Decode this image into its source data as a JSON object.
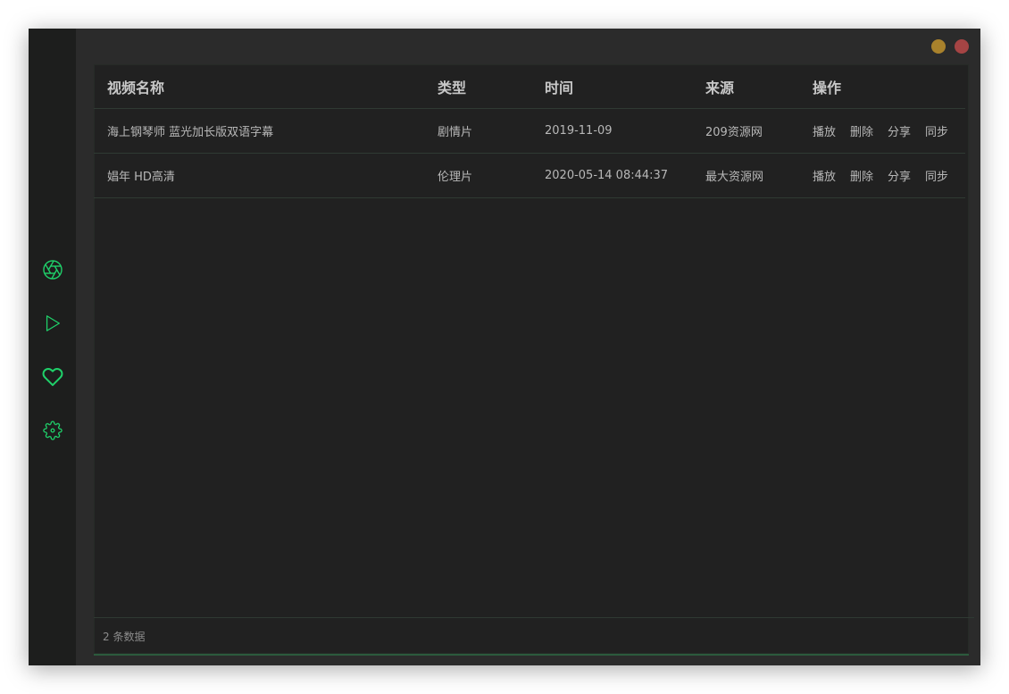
{
  "window": {
    "controls": {
      "minimize_color": "#a9822c",
      "close_color": "#a54444"
    }
  },
  "sidebar": {
    "accent_color": "#1fd16a",
    "items": [
      {
        "icon": "aperture-icon"
      },
      {
        "icon": "play-icon"
      },
      {
        "icon": "heart-icon"
      },
      {
        "icon": "gear-icon"
      }
    ]
  },
  "table": {
    "headers": {
      "name": "视频名称",
      "type": "类型",
      "time": "时间",
      "source": "来源",
      "actions": "操作"
    },
    "rows": [
      {
        "name": "海上钢琴师 蓝光加长版双语字幕",
        "type": "剧情片",
        "time": "2019-11-09",
        "source": "209资源网",
        "actions": [
          "播放",
          "删除",
          "分享",
          "同步"
        ]
      },
      {
        "name": "娼年 HD高清",
        "type": "伦理片",
        "time": "2020-05-14 08:44:37",
        "source": "最大资源网",
        "actions": [
          "播放",
          "删除",
          "分享",
          "同步"
        ]
      }
    ],
    "footer": "2 条数据"
  }
}
